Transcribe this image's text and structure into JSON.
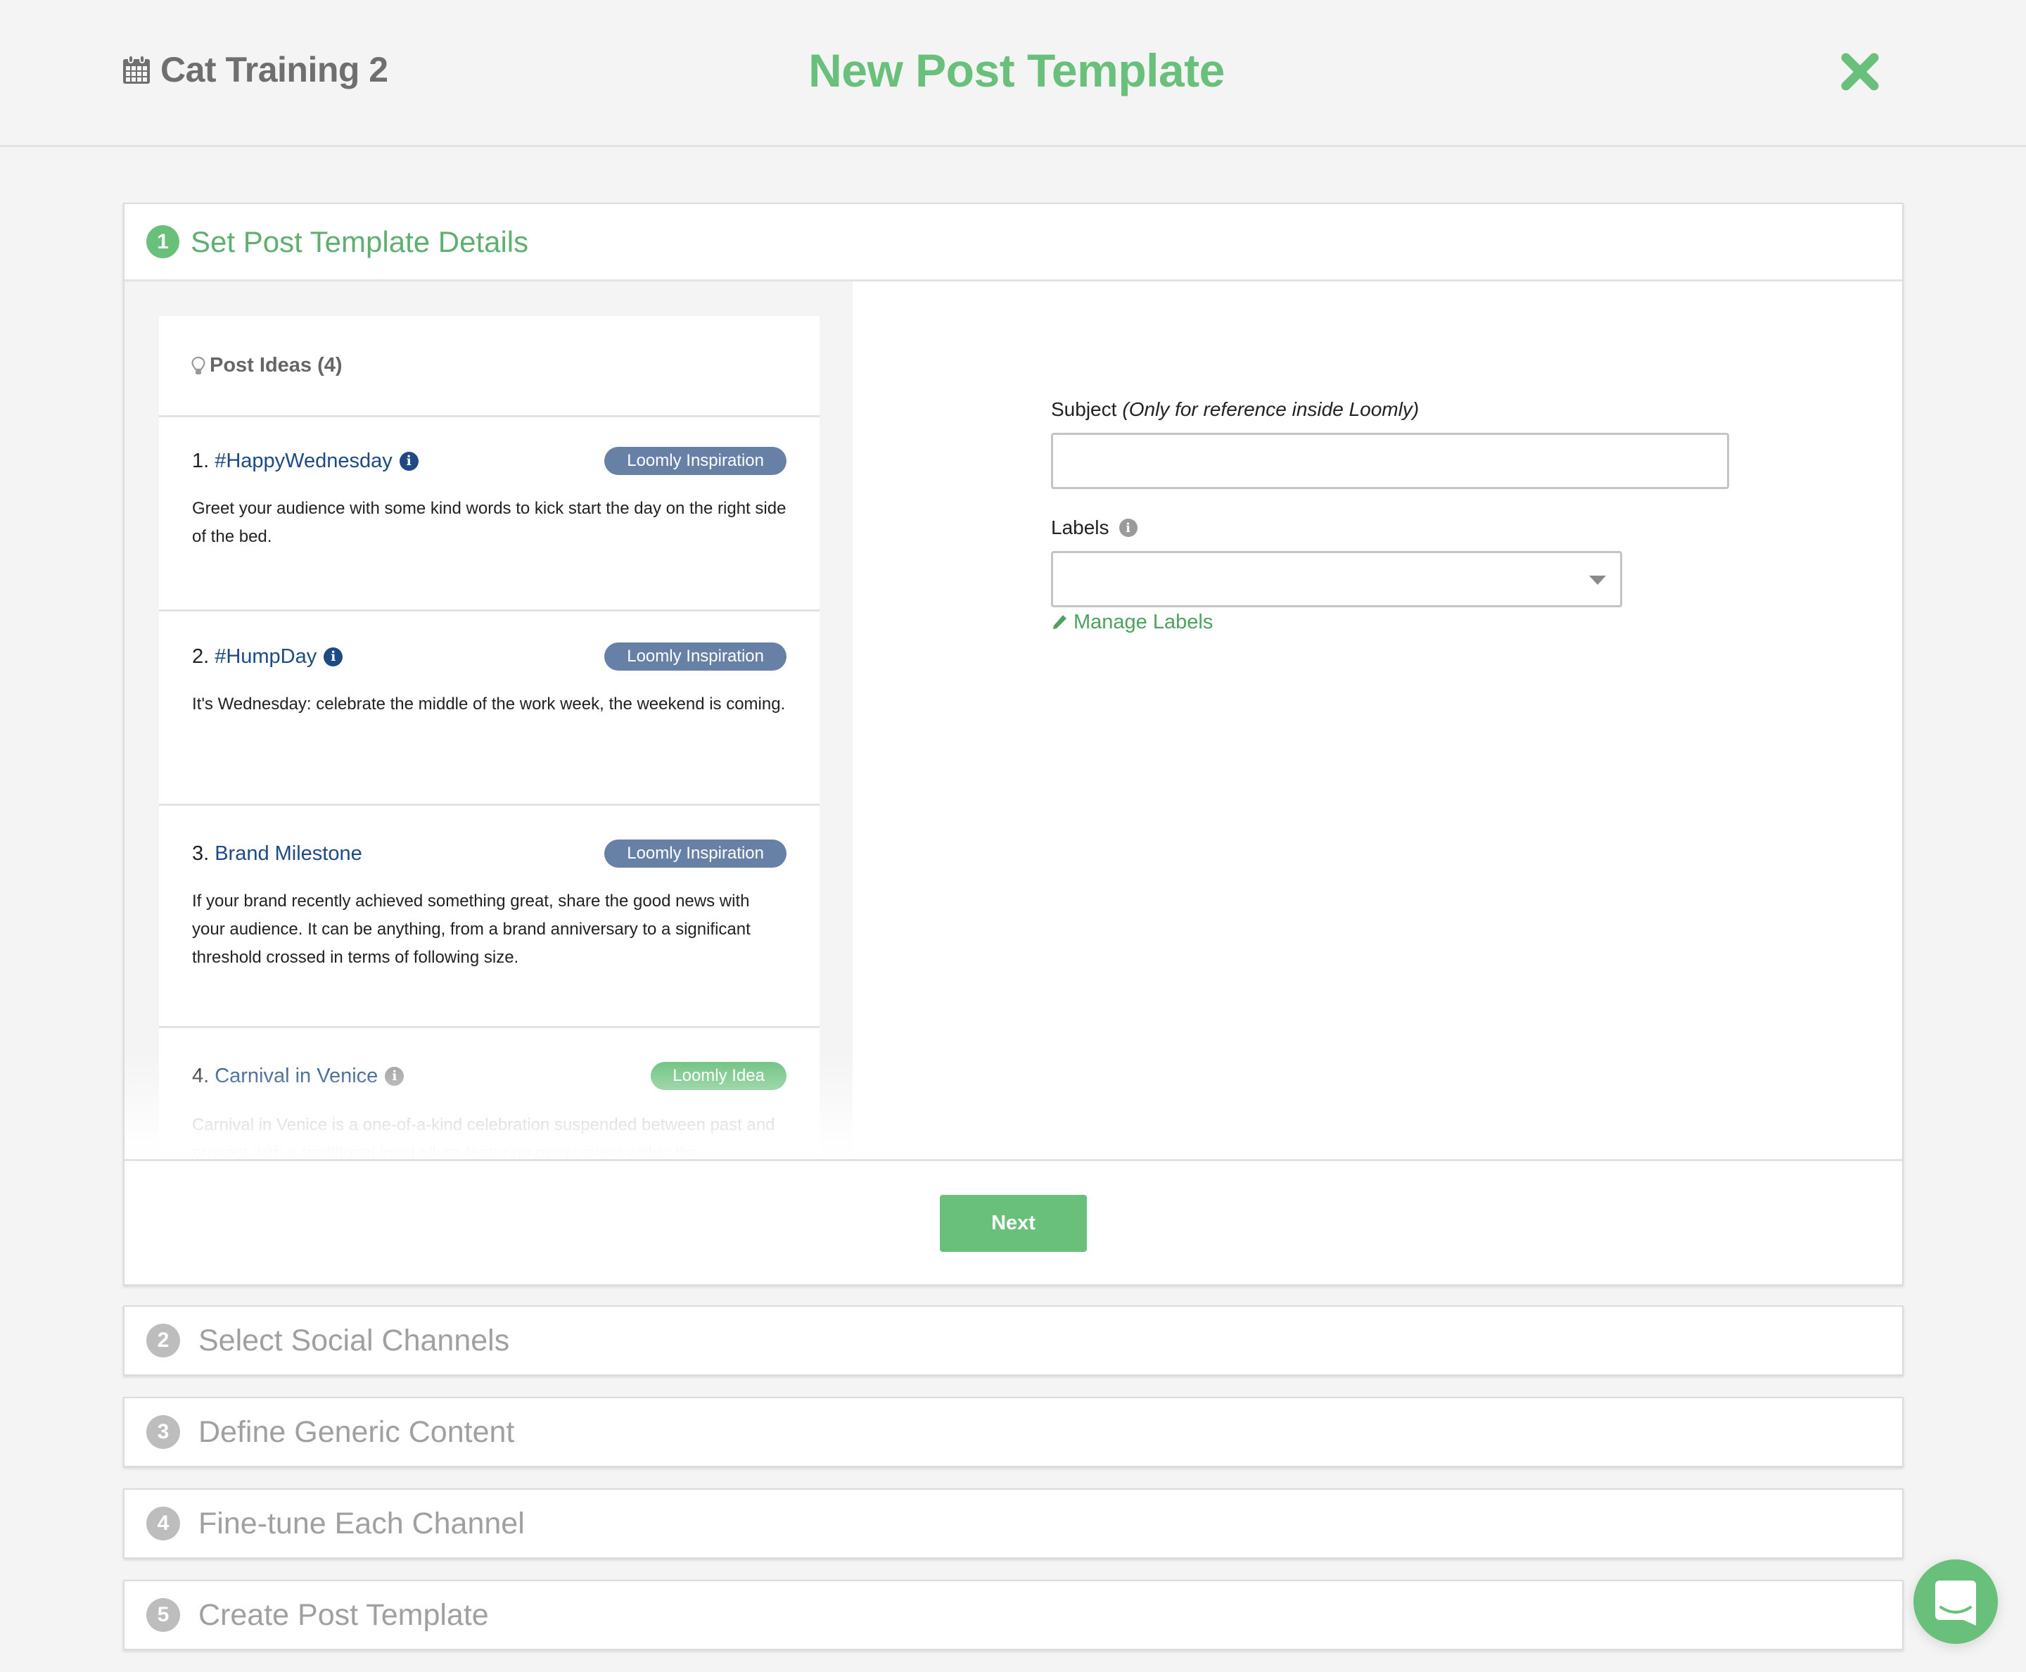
{
  "header": {
    "project_icon": "calendar-icon",
    "project_name": "Cat Training 2",
    "title": "New Post Template",
    "close_icon": "close-x-icon"
  },
  "colors": {
    "accent_green": "#68c07a",
    "link_blue": "#1d4a85",
    "badge_blue": "#6680a6",
    "muted_grey": "#a0a0a0",
    "page_bg": "#f4f4f4"
  },
  "steps": [
    {
      "number": "1",
      "title": "Set Post Template Details",
      "state": "active"
    },
    {
      "number": "2",
      "title": "Select Social Channels",
      "state": "collapsed"
    },
    {
      "number": "3",
      "title": "Define Generic Content",
      "state": "collapsed"
    },
    {
      "number": "4",
      "title": "Fine-tune Each Channel",
      "state": "collapsed"
    },
    {
      "number": "5",
      "title": "Create Post Template",
      "state": "collapsed"
    }
  ],
  "post_ideas": {
    "icon": "lightbulb-icon",
    "title": "Post Ideas (4)",
    "items": [
      {
        "index": "1.",
        "title": "#HappyWednesday",
        "info_icon": "info-circle-icon",
        "badge": "Loomly Inspiration",
        "description": "Greet your audience with some kind words to kick start the day on the right side of the bed."
      },
      {
        "index": "2.",
        "title": "#HumpDay",
        "info_icon": "info-circle-icon",
        "badge": "Loomly Inspiration",
        "description": "It's Wednesday: celebrate the middle of the work week, the weekend is coming."
      },
      {
        "index": "3.",
        "title": "Brand Milestone",
        "badge": "Loomly Inspiration",
        "description": "If your brand recently achieved something great, share the good news with your audience. It can be anything, from a brand anniversary to a significant threshold crossed in terms of following size."
      },
      {
        "index": "4.",
        "title": "Carnival in Venice",
        "info_icon": "info-circle-icon",
        "badge": "Loomly Idea",
        "description": "Carnival in Venice is a one-of-a-kind celebration suspended between past and present with a traditional local allure featuring many event within the"
      }
    ]
  },
  "form": {
    "subject_label": "Subject",
    "subject_hint": "(Only for reference inside Loomly)",
    "subject_value": "",
    "labels_label": "Labels",
    "labels_info_icon": "info-circle-icon",
    "labels_value": "",
    "manage_labels": "Manage Labels",
    "manage_labels_icon": "pencil-icon"
  },
  "footer": {
    "next_label": "Next"
  },
  "chat": {
    "icon": "chat-bubble-icon"
  }
}
